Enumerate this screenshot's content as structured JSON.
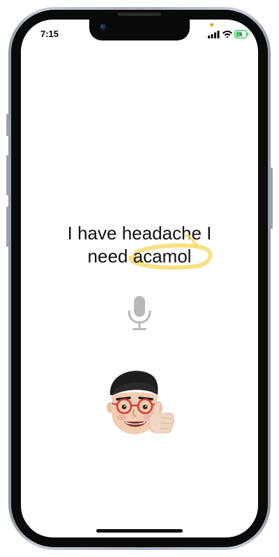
{
  "status_bar": {
    "time": "7:15",
    "icons": [
      "cellular-signal-icon",
      "wifi-icon",
      "battery-charging-icon"
    ]
  },
  "transcript": {
    "line1": "I have headache I",
    "line2_prefix": "need ",
    "highlighted_word": "acamol"
  },
  "colors": {
    "highlight": "#f7dc6f",
    "mic": "#b8b8b8",
    "text": "#111111"
  },
  "mic": {
    "icon": "microphone-icon"
  },
  "avatar": {
    "icon": "memoji-thumbs-up-avatar"
  }
}
